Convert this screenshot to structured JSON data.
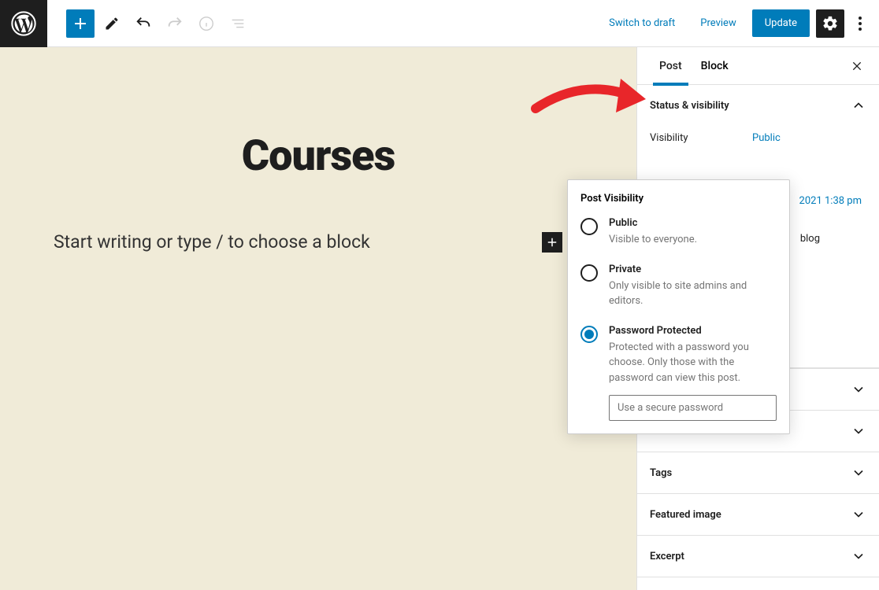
{
  "topbar": {
    "switch_draft": "Switch to draft",
    "preview": "Preview",
    "update": "Update"
  },
  "content": {
    "title": "Courses",
    "placeholder": "Start writing or type / to choose a block"
  },
  "sidebar": {
    "tabs": {
      "post": "Post",
      "block": "Block"
    },
    "status": {
      "header": "Status & visibility",
      "visibility_label": "Visibility",
      "visibility_value": "Public",
      "publish_peek": "2021 1:38 pm",
      "placement_peek": "blog"
    },
    "panels": {
      "tags": "Tags",
      "featured_image": "Featured image",
      "excerpt": "Excerpt"
    }
  },
  "popover": {
    "title": "Post Visibility",
    "options": [
      {
        "label": "Public",
        "desc": "Visible to everyone.",
        "selected": false
      },
      {
        "label": "Private",
        "desc": "Only visible to site admins and editors.",
        "selected": false
      },
      {
        "label": "Password Protected",
        "desc": "Protected with a password you choose. Only those with the password can view this post.",
        "selected": true
      }
    ],
    "password_placeholder": "Use a secure password"
  }
}
